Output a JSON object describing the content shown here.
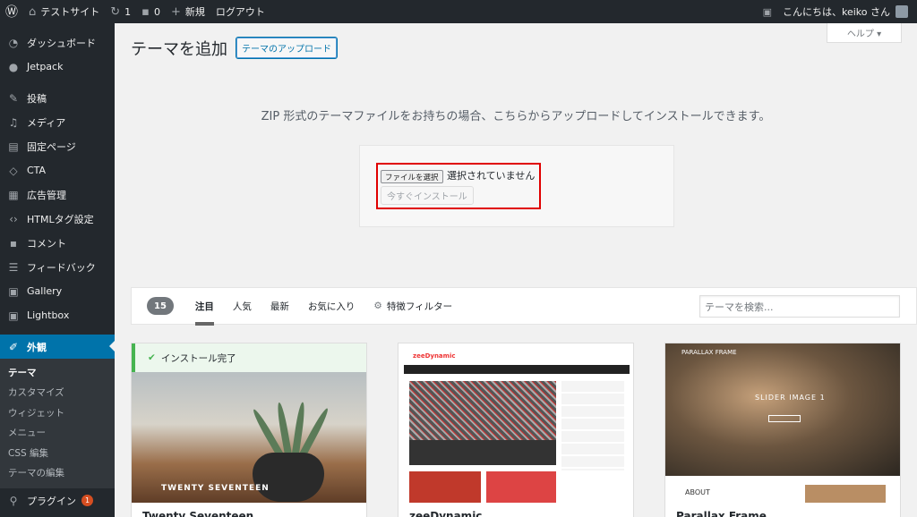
{
  "adminbar": {
    "site_name": "テストサイト",
    "updates_count": "1",
    "comments_count": "0",
    "new_label": "新規",
    "logout_label": "ログアウト",
    "greeting": "こんにちは、keiko さん"
  },
  "sidebar": {
    "items": [
      {
        "label": "ダッシュボード",
        "icon": "dashboard-icon"
      },
      {
        "label": "Jetpack",
        "icon": "jetpack-icon"
      },
      {
        "label": "投稿",
        "icon": "pin-icon"
      },
      {
        "label": "メディア",
        "icon": "media-icon"
      },
      {
        "label": "固定ページ",
        "icon": "page-icon"
      },
      {
        "label": "CTA",
        "icon": "cta-icon"
      },
      {
        "label": "広告管理",
        "icon": "ad-icon"
      },
      {
        "label": "HTMLタグ設定",
        "icon": "code-icon"
      },
      {
        "label": "コメント",
        "icon": "comment-icon"
      },
      {
        "label": "フィードバック",
        "icon": "feedback-icon"
      },
      {
        "label": "Gallery",
        "icon": "gallery-icon"
      },
      {
        "label": "Lightbox",
        "icon": "lightbox-icon"
      },
      {
        "label": "外観",
        "icon": "paintbrush-icon"
      }
    ],
    "submenu": [
      "テーマ",
      "カスタマイズ",
      "ウィジェット",
      "メニュー",
      "CSS 編集",
      "テーマの編集"
    ],
    "plugins": {
      "label": "プラグイン",
      "badge": "1"
    }
  },
  "main": {
    "help_label": "ヘルプ ▾",
    "title": "テーマを追加",
    "upload_button": "テーマのアップロード",
    "upload_help": "ZIP 形式のテーマファイルをお持ちの場合、こちらからアップロードしてインストールできます。",
    "file_button": "ファイルを選択",
    "file_status": "選択されていません",
    "install_button": "今すぐインストール"
  },
  "filter": {
    "count": "15",
    "tabs": [
      "注目",
      "人気",
      "最新",
      "お気に入り"
    ],
    "feature_filter": "特徴フィルター",
    "search_placeholder": "テーマを検索..."
  },
  "themes": [
    {
      "name": "Twenty Seventeen",
      "installed_label": "インストール完了",
      "screenshot_text": "TWENTY SEVENTEEN"
    },
    {
      "name": "zeeDynamic",
      "screenshot_text": "zeeDynamic"
    },
    {
      "name": "Parallax Frame",
      "screenshot_text": "PARALLAX FRAME",
      "slider_text": "SLIDER IMAGE 1",
      "about_text": "ABOUT"
    }
  ],
  "colors": {
    "admin_dark": "#23282d",
    "active_menu": "#0073aa",
    "highlight": "#e00000",
    "installed_green": "#46b450"
  }
}
